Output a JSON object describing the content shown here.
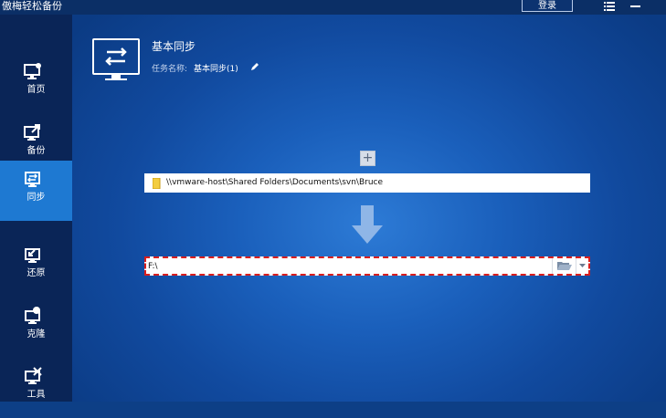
{
  "app": {
    "title": "傲梅轻松备份",
    "login_label": "登录"
  },
  "sidebar": {
    "items": [
      {
        "label": "首页",
        "icon": "home-monitor-icon",
        "active": false
      },
      {
        "label": "备份",
        "icon": "backup-export-icon",
        "active": false
      },
      {
        "label": "同步",
        "icon": "sync-icon",
        "active": true
      },
      {
        "label": "还原",
        "icon": "restore-icon",
        "active": false
      },
      {
        "label": "克隆",
        "icon": "clone-icon",
        "active": false
      },
      {
        "label": "工具",
        "icon": "tools-icon",
        "active": false
      }
    ]
  },
  "header": {
    "title": "基本同步",
    "task_name_label": "任务名称:",
    "task_name_value": "基本同步(1)"
  },
  "source": {
    "path": "\\\\vmware-host\\Shared Folders\\Documents\\svn\\Bruce"
  },
  "destination": {
    "path": "F:\\"
  },
  "colors": {
    "sidebar_bg": "#0a2557",
    "sidebar_active": "#1e79d2",
    "titlebar_bg": "#0b2f66",
    "main_bg_center": "#2d7bd6",
    "main_bg_edge": "#0b3b84",
    "dest_border": "#d91d1d"
  }
}
